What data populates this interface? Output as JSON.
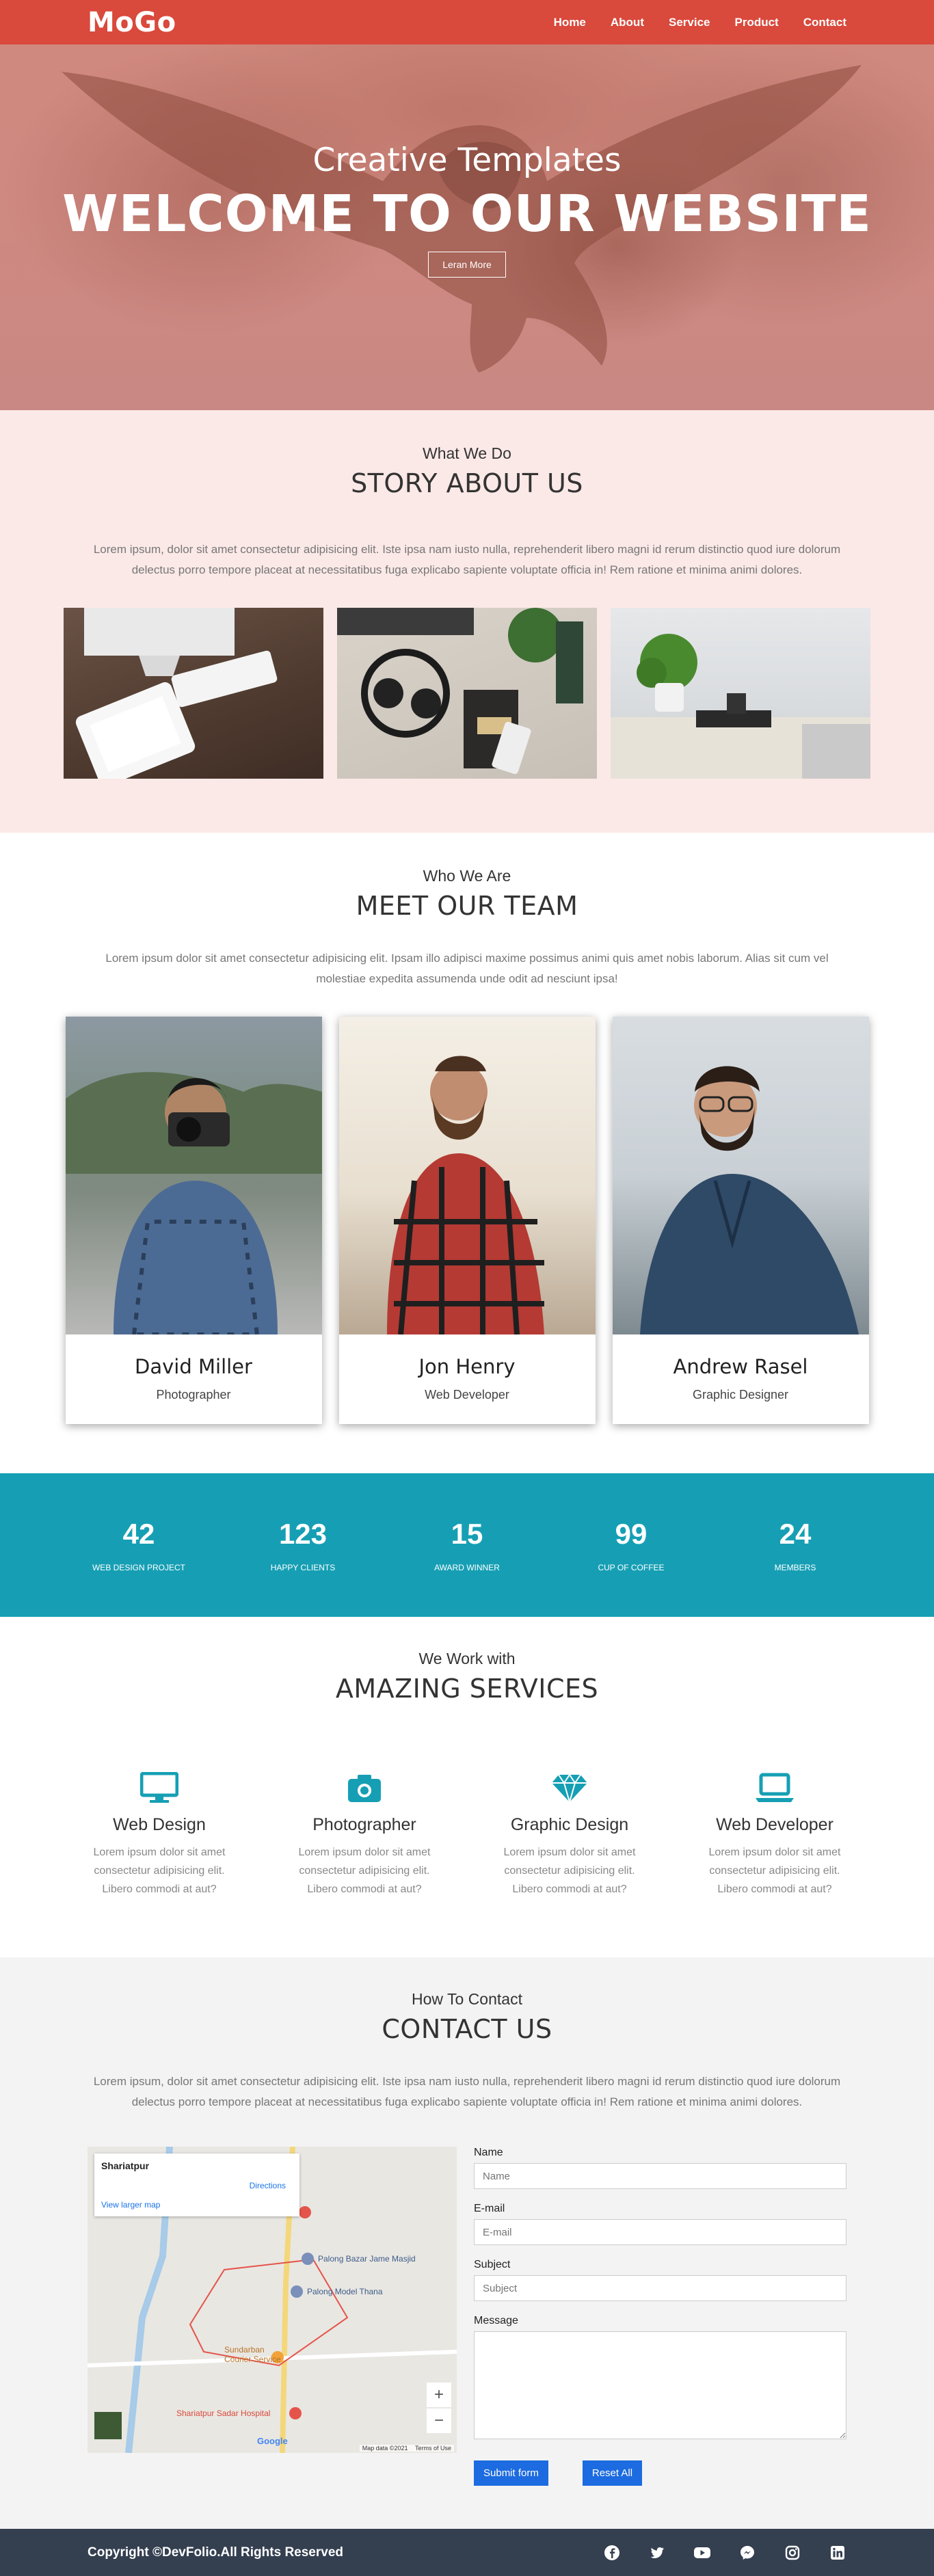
{
  "nav": {
    "brand": "MoGo",
    "items": [
      "Home",
      "About",
      "Service",
      "Product",
      "Contact"
    ]
  },
  "hero": {
    "subtitle": "Creative Templates",
    "title": "WELCOME TO OUR WEBSITE",
    "button": "Leran More"
  },
  "story": {
    "eyebrow": "What We Do",
    "heading": "STORY ABOUT US",
    "text": "Lorem ipsum, dolor sit amet consectetur adipisicing elit. Iste ipsa nam iusto nulla, reprehenderit libero magni id rerum distinctio quod iure dolorum delectus porro tempore placeat at necessitatibus fuga explicabo sapiente voluptate officia in! Rem ratione et minima animi dolores."
  },
  "team": {
    "eyebrow": "Who We Are",
    "heading": "MEET OUR TEAM",
    "text": "Lorem ipsum dolor sit amet consectetur adipisicing elit. Ipsam illo adipisci maxime possimus animi quis amet nobis laborum. Alias sit cum vel molestiae expedita assumenda unde odit ad nesciunt ipsa!",
    "members": [
      {
        "name": "David Miller",
        "role": "Photographer"
      },
      {
        "name": "Jon Henry",
        "role": "Web Developer"
      },
      {
        "name": "Andrew Rasel",
        "role": "Graphic Designer"
      }
    ]
  },
  "counters": [
    {
      "value": "42",
      "label": "WEB DESIGN PROJECT"
    },
    {
      "value": "123",
      "label": "HAPPY CLIENTS"
    },
    {
      "value": "15",
      "label": "AWARD WINNER"
    },
    {
      "value": "99",
      "label": "CUP OF COFFEE"
    },
    {
      "value": "24",
      "label": "MEMBERS"
    }
  ],
  "services": {
    "eyebrow": "We Work with",
    "heading": "AMAZING SERVICES",
    "items": [
      {
        "title": "Web Design",
        "icon": "desktop-icon",
        "text": "Lorem ipsum dolor sit amet consectetur adipisicing elit. Libero commodi at aut?"
      },
      {
        "title": "Photographer",
        "icon": "camera-icon",
        "text": "Lorem ipsum dolor sit amet consectetur adipisicing elit. Libero commodi at aut?"
      },
      {
        "title": "Graphic Design",
        "icon": "diamond-icon",
        "text": "Lorem ipsum dolor sit amet consectetur adipisicing elit. Libero commodi at aut?"
      },
      {
        "title": "Web Developer",
        "icon": "laptop-icon",
        "text": "Lorem ipsum dolor sit amet consectetur adipisicing elit. Libero commodi at aut?"
      }
    ],
    "accent": "#169fb4"
  },
  "contact": {
    "eyebrow": "How To Contact",
    "heading": "CONTACT US",
    "text": "Lorem ipsum, dolor sit amet consectetur adipisicing elit. Iste ipsa nam iusto nulla, reprehenderit libero magni id rerum distinctio quod iure dolorum delectus porro tempore placeat at necessitatibus fuga explicabo sapiente voluptate officia in! Rem ratione et minima animi dolores.",
    "map": {
      "place": "Shariatpur",
      "directions": "Directions",
      "view_larger": "View larger map",
      "labels": [
        "Palong Bazar Jame Masjid",
        "Palong Model Thana",
        "Sundarban Courier Service",
        "Shariatpur Sadar Hospital"
      ],
      "attribution": "Map data ©2021",
      "terms": "Terms of Use",
      "google": "Google",
      "zoom_in": "+",
      "zoom_out": "−"
    },
    "form": {
      "name_label": "Name",
      "name_placeholder": "Name",
      "email_label": "E-mail",
      "email_placeholder": "E-mail",
      "subject_label": "Subject",
      "subject_placeholder": "Subject",
      "message_label": "Message",
      "submit": "Submit form",
      "reset": "Reset All"
    }
  },
  "footer": {
    "copyright": "Copyright ©DevFolio.All Rights Reserved",
    "social": [
      "facebook-icon",
      "twitter-icon",
      "youtube-icon",
      "messenger-icon",
      "instagram-icon",
      "linkedin-icon"
    ]
  },
  "colors": {
    "nav": "#d9493c",
    "story_bg": "#fbe9e7",
    "counter_bg": "#169fb4",
    "footer_bg": "#343f50",
    "button": "#1c6be0"
  }
}
